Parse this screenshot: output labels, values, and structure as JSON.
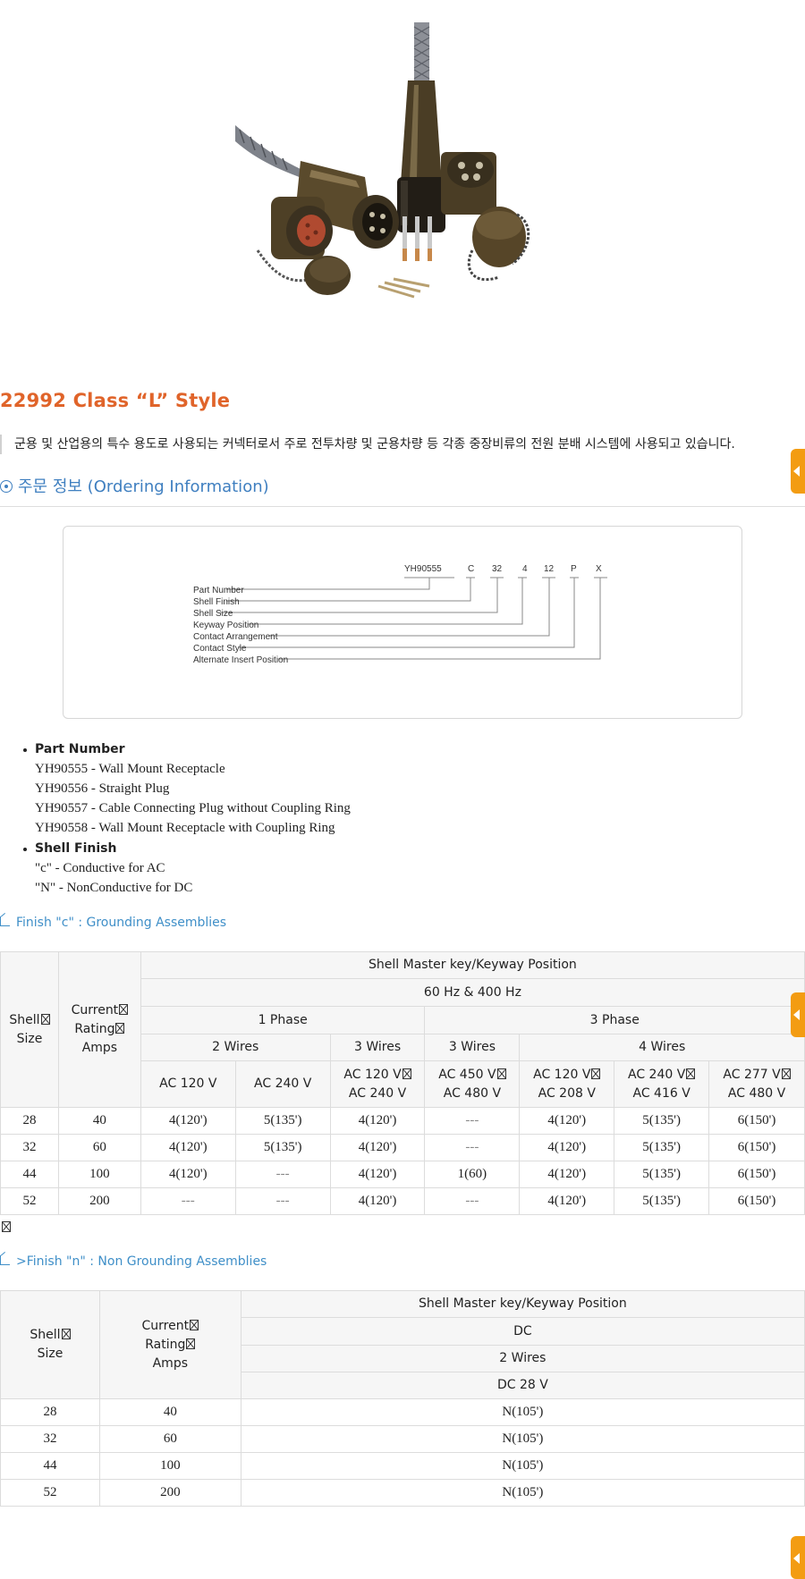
{
  "title": "22992 Class “L” Style",
  "description": "군용 및 산업용의 특수 용도로 사용되는 커넥터로서 주로 전투차량 및 군용차량 등 각종 중장비류의 전원 분배 시스템에 사용되고 있습니다.",
  "ordering": {
    "heading": "주문 정보 (Ordering Information)",
    "code_parts": [
      "YH90555",
      "C",
      "32",
      "4",
      "12",
      "P",
      "X"
    ],
    "labels": [
      "Part Number",
      "Shell Finish",
      "Shell Size",
      "Keyway Position",
      "Contact Arrangement",
      "Contact Style",
      "Alternate Insert Position"
    ]
  },
  "part_number": {
    "heading": "Part Number",
    "items": [
      "YH90555 - Wall Mount Receptacle",
      "YH90556 - Straight Plug",
      "YH90557 - Cable Connecting Plug without Coupling Ring",
      "YH90558 - Wall Mount Receptacle with Coupling Ring"
    ]
  },
  "shell_finish": {
    "heading": "Shell Finish",
    "items": [
      "\"c\" - Conductive for AC",
      "\"N\" - NonConductive for DC"
    ]
  },
  "table_c": {
    "heading": "Finish \"c\" : Grounding Assemblies",
    "h_shell": "Shell",
    "h_size": "Size",
    "h_current": "Current",
    "h_rating": "Rating",
    "h_amps": "Amps",
    "h_master": "Shell Master key/Keyway Position",
    "h_freq": "60 Hz & 400 Hz",
    "h_1phase": "1 Phase",
    "h_3phase": "3 Phase",
    "h_2wires": "2 Wires",
    "h_3wires_a": "3 Wires",
    "h_3wires_b": "3 Wires",
    "h_4wires": "4 Wires",
    "volts": [
      [
        "AC 120 V",
        ""
      ],
      [
        "AC 240 V",
        ""
      ],
      [
        "AC 120 V",
        "AC 240 V"
      ],
      [
        "AC 450 V",
        "AC 480 V"
      ],
      [
        "AC 120 V",
        "AC 208 V"
      ],
      [
        "AC 240 V",
        "AC 416 V"
      ],
      [
        "AC 277 V",
        "AC 480 V"
      ]
    ],
    "rows": [
      [
        "28",
        "40",
        "4(120')",
        "5(135')",
        "4(120')",
        "---",
        "4(120')",
        "5(135')",
        "6(150')"
      ],
      [
        "32",
        "60",
        "4(120')",
        "5(135')",
        "4(120')",
        "---",
        "4(120')",
        "5(135')",
        "6(150')"
      ],
      [
        "44",
        "100",
        "4(120')",
        "---",
        "4(120')",
        "1(60)",
        "4(120')",
        "5(135')",
        "6(150')"
      ],
      [
        "52",
        "200",
        "---",
        "---",
        "4(120')",
        "---",
        "4(120')",
        "5(135')",
        "6(150')"
      ]
    ]
  },
  "table_n": {
    "heading": ">Finish \"n\" : Non Grounding Assemblies",
    "h_shell": "Shell",
    "h_size": "Size",
    "h_current": "Current",
    "h_rating": "Rating",
    "h_amps": "Amps",
    "h_master": "Shell Master key/Keyway Position",
    "h_dc": "DC",
    "h_2wires": "2 Wires",
    "h_volt": "DC 28 V",
    "rows": [
      [
        "28",
        "40",
        "N(105')"
      ],
      [
        "32",
        "60",
        "N(105')"
      ],
      [
        "44",
        "100",
        "N(105')"
      ],
      [
        "52",
        "200",
        "N(105')"
      ]
    ]
  },
  "icons": [
    "connector-product-photo",
    "circle-bullet-icon",
    "corner-arrow-icon",
    "scroll-top-tab-icon"
  ],
  "colors": {
    "title": "#e0642a",
    "section": "#3f7fc0",
    "subheading": "#3f8fc8",
    "side_tab": "#f39c12"
  }
}
